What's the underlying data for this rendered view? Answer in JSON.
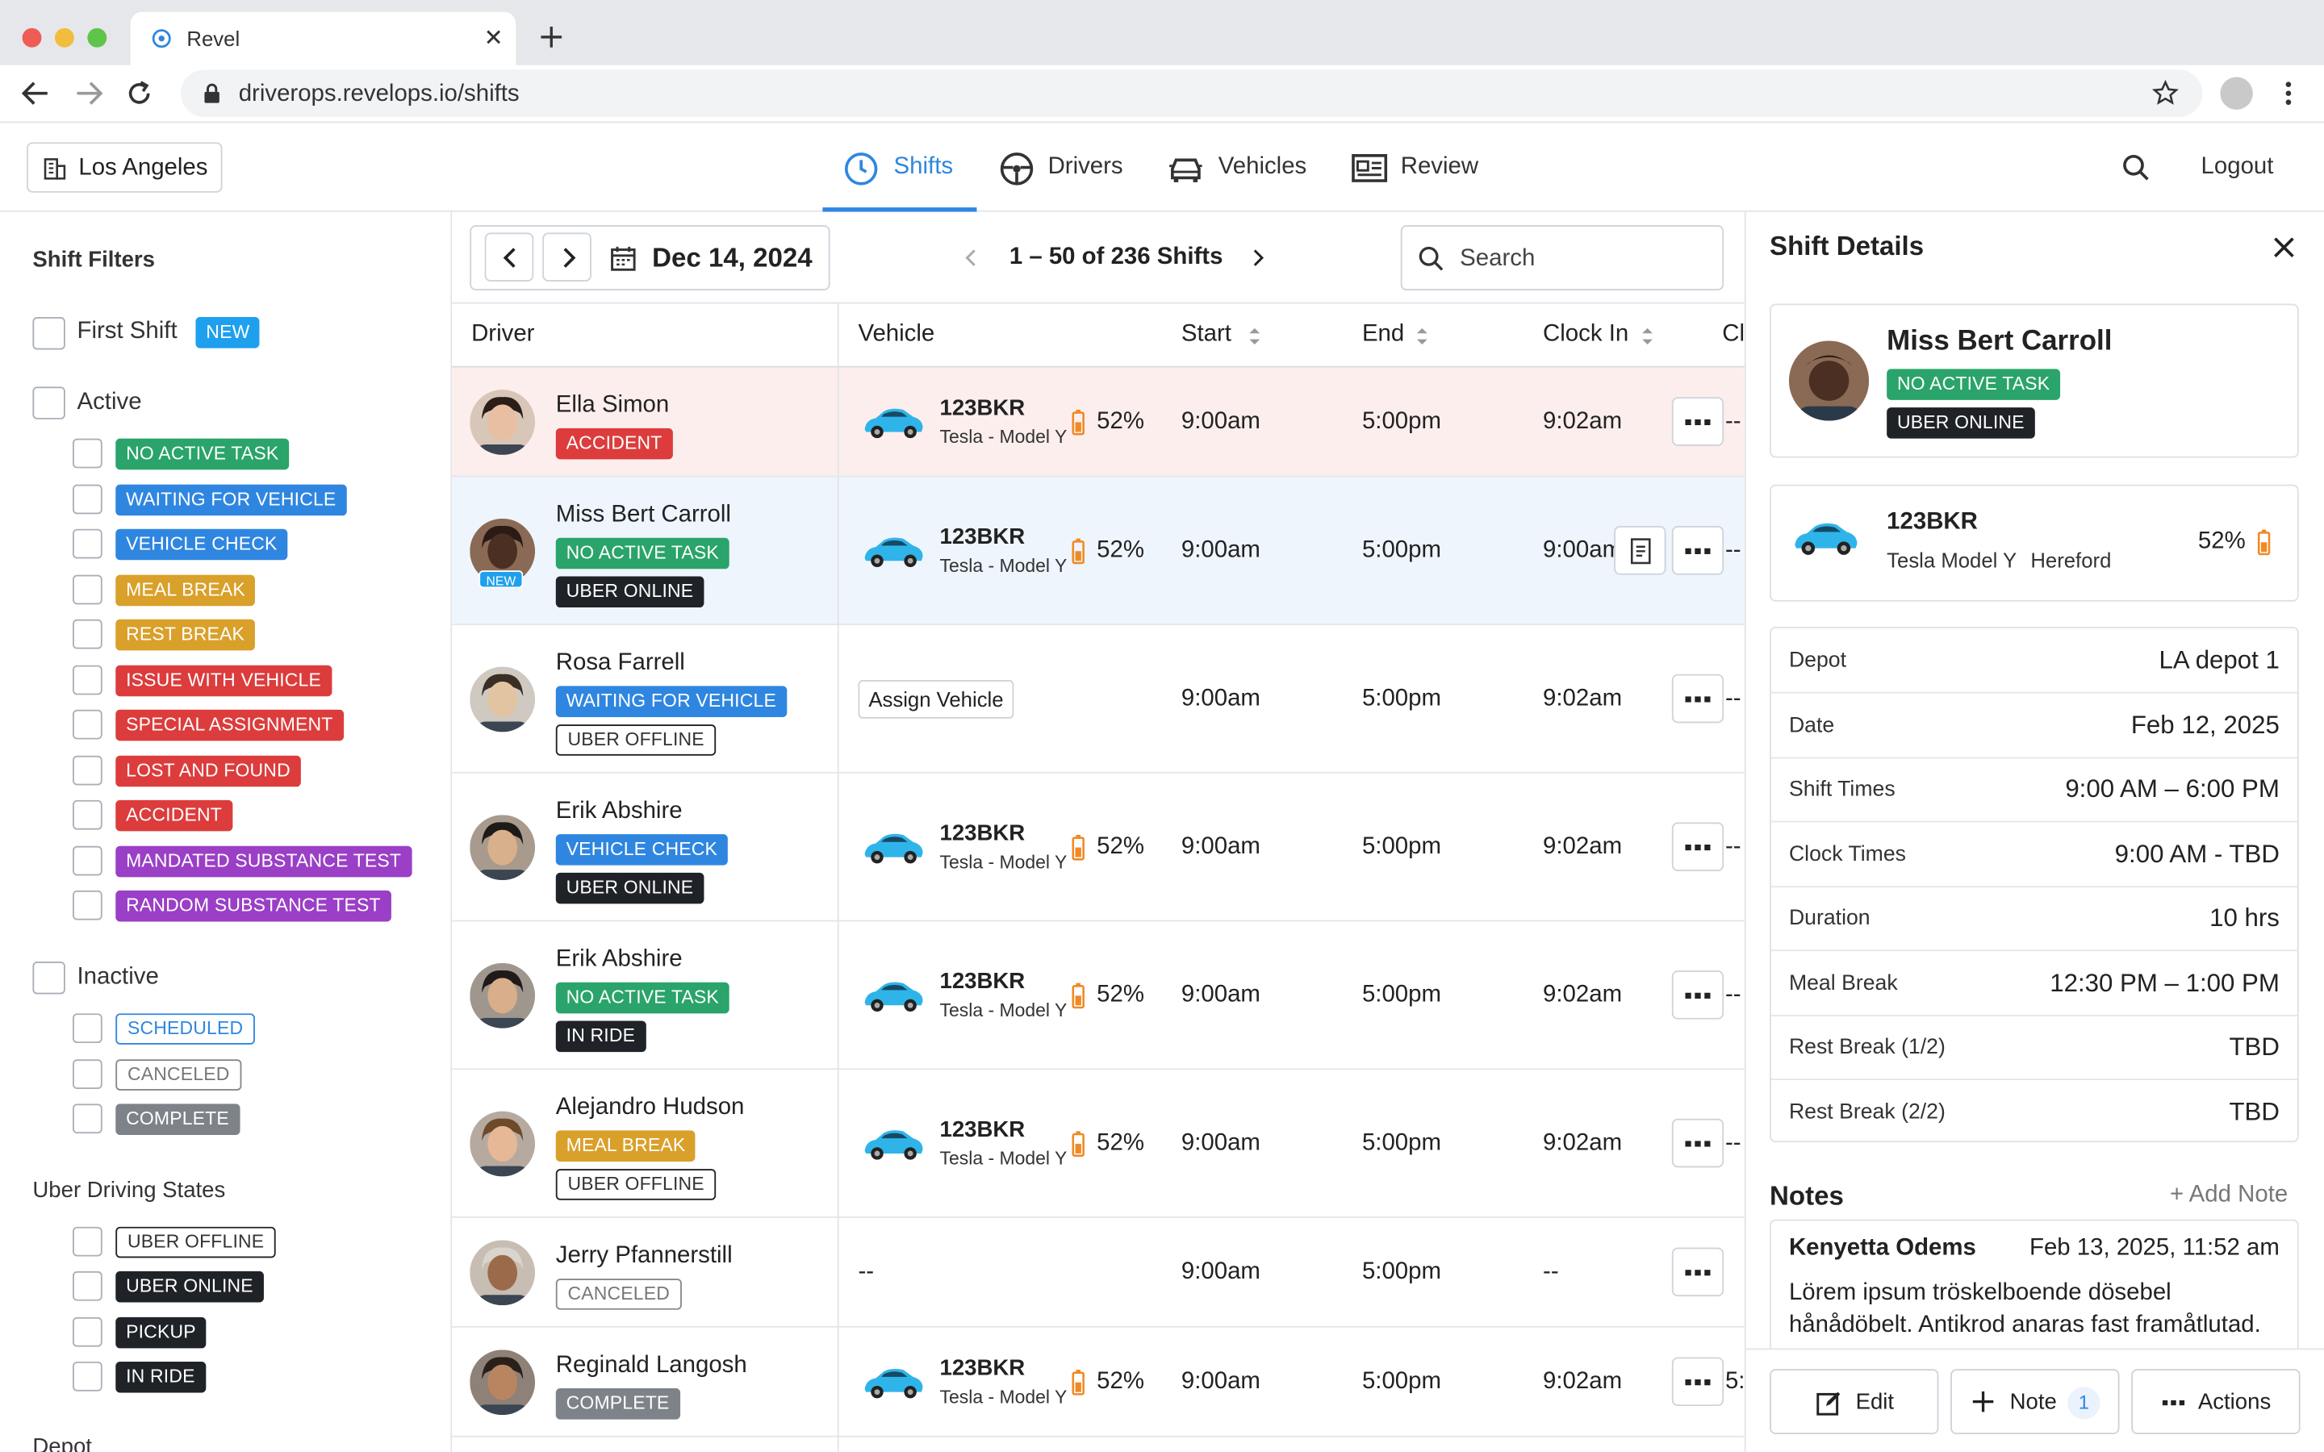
{
  "browser": {
    "tab_title": "Revel",
    "url": "driverops.revelops.io/shifts"
  },
  "header": {
    "location": "Los Angeles",
    "tabs": [
      {
        "label": "Shifts",
        "icon": "clock-icon",
        "active": true
      },
      {
        "label": "Drivers",
        "icon": "steering-wheel-icon"
      },
      {
        "label": "Vehicles",
        "icon": "car-icon"
      },
      {
        "label": "Review",
        "icon": "id-card-icon"
      }
    ],
    "logout": "Logout"
  },
  "filters": {
    "title": "Shift Filters",
    "first_shift": "First Shift",
    "first_shift_badge": "NEW",
    "active_label": "Active",
    "active_items": [
      {
        "label": "NO ACTIVE TASK",
        "color": "#2aa46a"
      },
      {
        "label": "WAITING FOR VEHICLE",
        "color": "#2f86e0"
      },
      {
        "label": "VEHICLE CHECK",
        "color": "#2f86e0"
      },
      {
        "label": "MEAL BREAK",
        "color": "#d9a02a"
      },
      {
        "label": "REST BREAK",
        "color": "#d9a02a"
      },
      {
        "label": "ISSUE WITH VEHICLE",
        "color": "#dc3c3c"
      },
      {
        "label": "SPECIAL ASSIGNMENT",
        "color": "#dc3c3c"
      },
      {
        "label": "LOST AND FOUND",
        "color": "#dc3c3c"
      },
      {
        "label": "ACCIDENT",
        "color": "#dc3c3c"
      },
      {
        "label": "MANDATED SUBSTANCE TEST",
        "color": "#9a3fc6"
      },
      {
        "label": "RANDOM SUBSTANCE TEST",
        "color": "#9a3fc6"
      }
    ],
    "inactive_label": "Inactive",
    "inactive_items": [
      "SCHEDULED",
      "CANCELED",
      "COMPLETE"
    ],
    "uber_title": "Uber Driving States",
    "uber_items": [
      "UBER OFFLINE",
      "UBER ONLINE",
      "PICKUP",
      "IN RIDE"
    ],
    "depot_title": "Depot"
  },
  "toolbar": {
    "date": "Dec 14, 2024",
    "pager": "1 – 50 of 236 Shifts",
    "search_placeholder": "Search"
  },
  "table": {
    "columns": [
      "Driver",
      "Vehicle",
      "Start",
      "End",
      "Clock In",
      "Cl"
    ],
    "rows": [
      {
        "name": "Ella Simon",
        "tags": [
          "ACCIDENT"
        ],
        "plate": "123BKR",
        "model": "Tesla - Model Y",
        "battery": "52%",
        "start": "9:00am",
        "end": "5:00pm",
        "clock_in": "9:02am",
        "trail": "--",
        "highlight": "red"
      },
      {
        "name": "Miss Bert Carroll",
        "tags": [
          "NO ACTIVE TASK",
          "UBER ONLINE"
        ],
        "avatar_badge": "NEW",
        "plate": "123BKR",
        "model": "Tesla - Model Y",
        "battery": "52%",
        "start": "9:00am",
        "end": "5:00pm",
        "clock_in": "9:00am",
        "trail": "--",
        "highlight": "blue"
      },
      {
        "name": "Rosa Farrell",
        "tags": [
          "WAITING FOR VEHICLE",
          "UBER OFFLINE"
        ],
        "assign": "Assign Vehicle",
        "start": "9:00am",
        "end": "5:00pm",
        "clock_in": "9:02am",
        "trail": "--"
      },
      {
        "name": "Erik Abshire",
        "tags": [
          "VEHICLE CHECK",
          "UBER ONLINE"
        ],
        "plate": "123BKR",
        "model": "Tesla - Model Y",
        "battery": "52%",
        "start": "9:00am",
        "end": "5:00pm",
        "clock_in": "9:02am",
        "trail": "--"
      },
      {
        "name": "Erik Abshire",
        "tags": [
          "NO ACTIVE TASK",
          "IN RIDE"
        ],
        "plate": "123BKR",
        "model": "Tesla - Model Y",
        "battery": "52%",
        "start": "9:00am",
        "end": "5:00pm",
        "clock_in": "9:02am",
        "trail": "--"
      },
      {
        "name": "Alejandro Hudson",
        "tags": [
          "MEAL BREAK",
          "UBER OFFLINE"
        ],
        "plate": "123BKR",
        "model": "Tesla - Model Y",
        "battery": "52%",
        "start": "9:00am",
        "end": "5:00pm",
        "clock_in": "9:02am",
        "trail": "--"
      },
      {
        "name": "Jerry Pfannerstill",
        "tags": [
          "CANCELED"
        ],
        "no_vehicle": "--",
        "start": "9:00am",
        "end": "5:00pm",
        "clock_in": "--",
        "trail": ""
      },
      {
        "name": "Reginald Langosh",
        "tags": [
          "COMPLETE"
        ],
        "plate": "123BKR",
        "model": "Tesla - Model Y",
        "battery": "52%",
        "start": "9:00am",
        "end": "5:00pm",
        "clock_in": "9:02am",
        "trail": "5:"
      }
    ]
  },
  "panel": {
    "title": "Shift Details",
    "driver_name": "Miss Bert Carroll",
    "driver_tags": [
      "NO ACTIVE TASK",
      "UBER ONLINE"
    ],
    "vehicle_plate": "123BKR",
    "vehicle_model": "Tesla Model Y",
    "vehicle_depot": "Hereford",
    "vehicle_battery": "52%",
    "details": [
      {
        "k": "Depot",
        "v": "LA depot 1"
      },
      {
        "k": "Date",
        "v": "Feb 12, 2025"
      },
      {
        "k": "Shift Times",
        "v": "9:00 AM – 6:00 PM"
      },
      {
        "k": "Clock Times",
        "v": "9:00 AM - TBD"
      },
      {
        "k": "Duration",
        "v": "10 hrs"
      },
      {
        "k": "Meal Break",
        "v": "12:30 PM – 1:00 PM"
      },
      {
        "k": "Rest Break (1/2)",
        "v": "TBD"
      },
      {
        "k": "Rest Break (2/2)",
        "v": "TBD"
      }
    ],
    "notes_title": "Notes",
    "add_note": "+ Add Note",
    "note_author": "Kenyetta Odems",
    "note_time": "Feb 13, 2025, 11:52 am",
    "note_text": "Lörem ipsum tröskelboende dösebel hånådöbelt. Antikrod anaras fast framåtlutad.",
    "buttons": {
      "edit": "Edit",
      "note": "Note",
      "note_count": "1",
      "actions": "Actions"
    }
  }
}
